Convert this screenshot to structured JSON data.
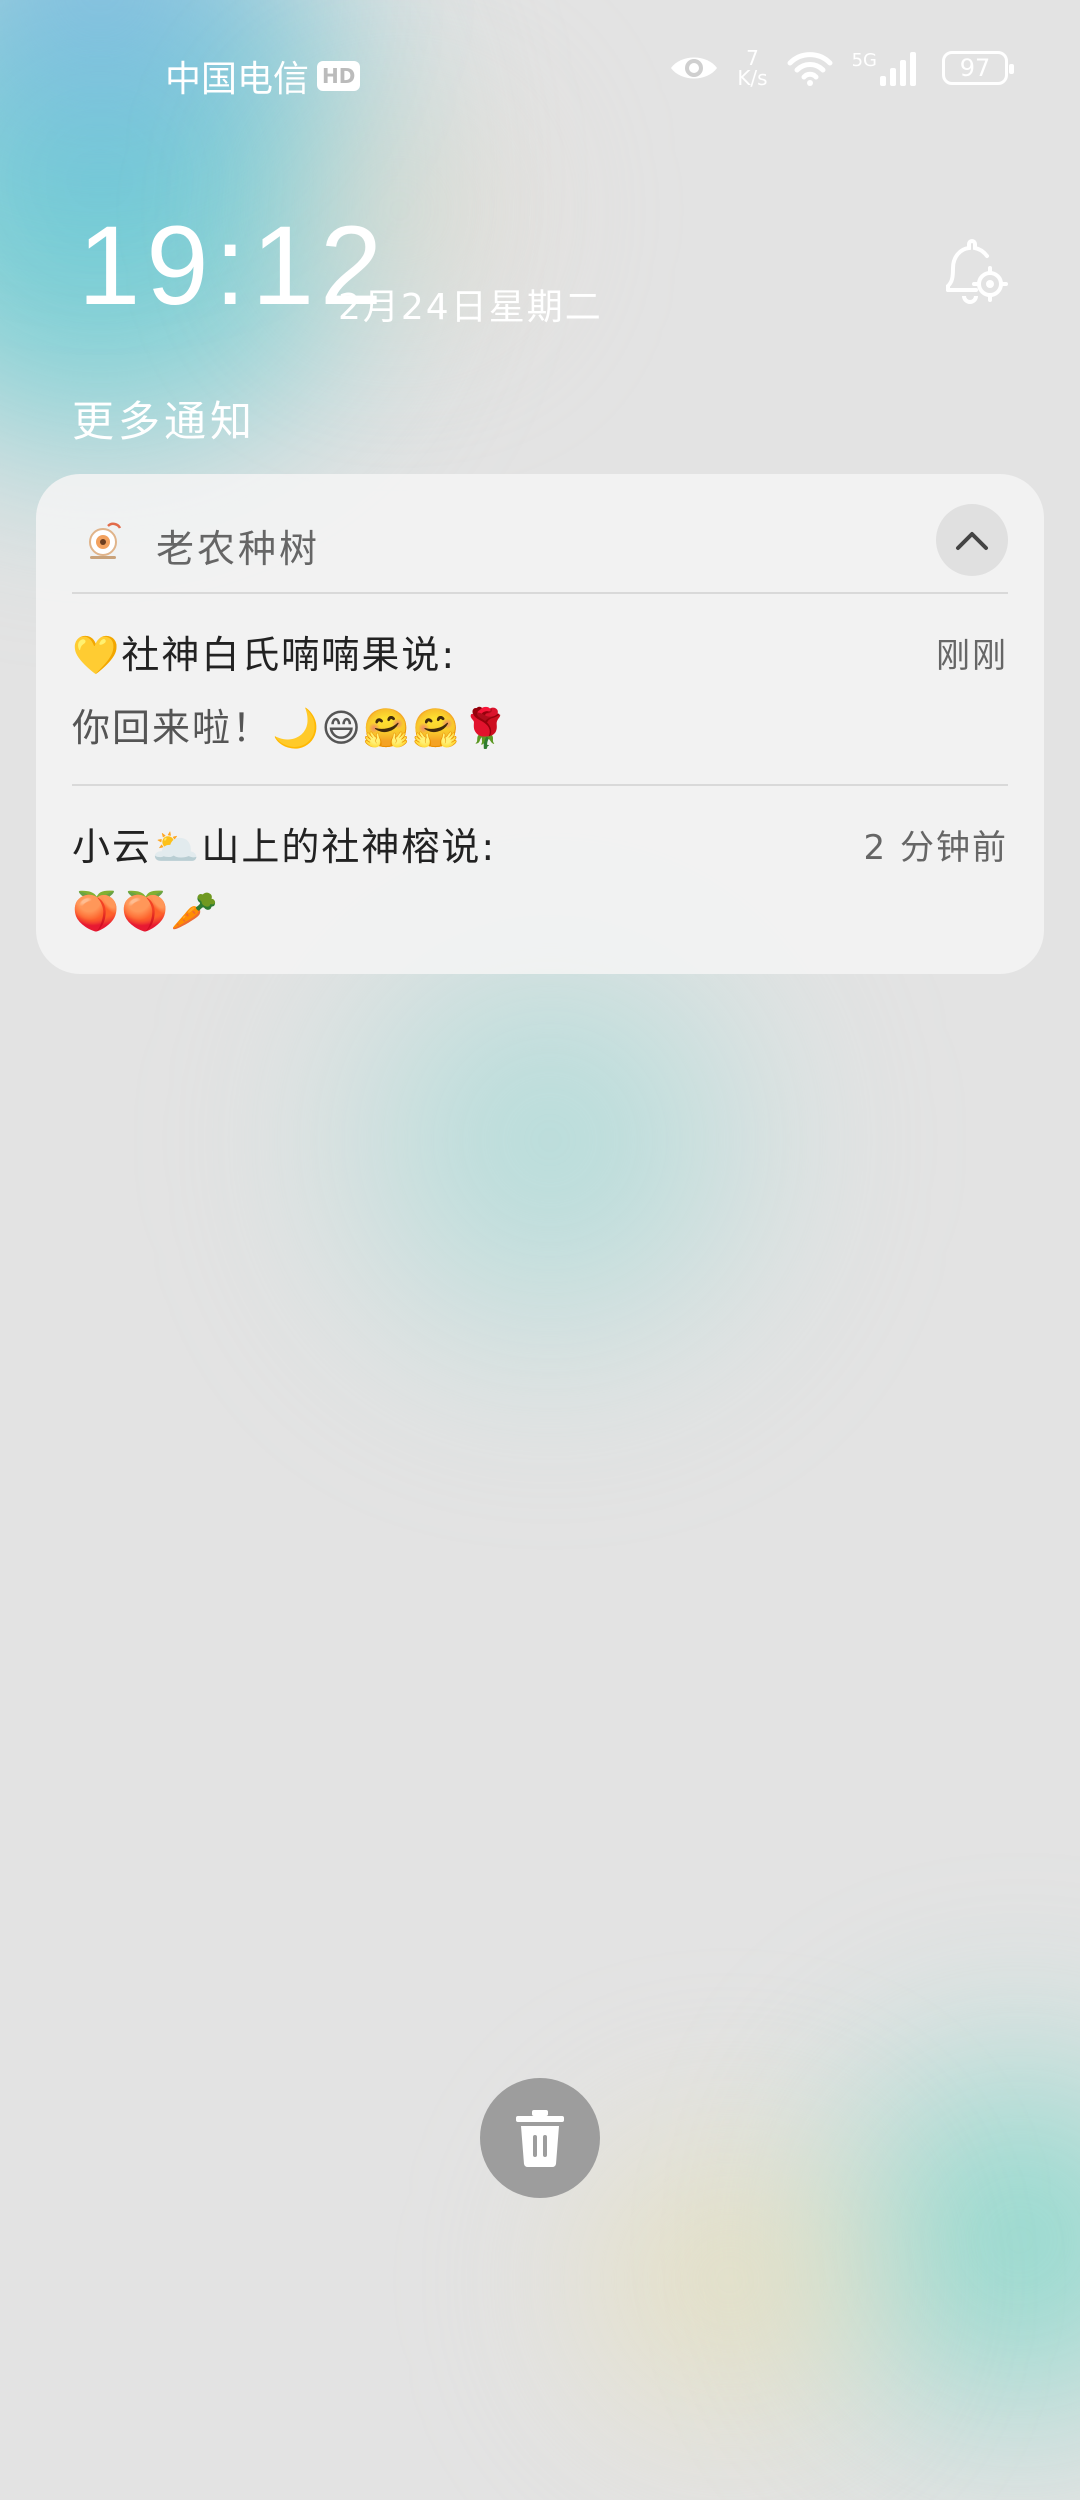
{
  "status_bar": {
    "carrier": "中国电信",
    "hd_badge": "HD",
    "speed_value": "7",
    "speed_unit": "K/s",
    "network": "5G",
    "battery": "97"
  },
  "lockscreen": {
    "time": "19:12",
    "date": "2月24日星期二"
  },
  "section_title": "更多通知",
  "notification": {
    "app_name": "老农种树",
    "messages": [
      {
        "sender": "💛社神白氏喃喃果说:",
        "time": "刚刚",
        "text": "你回来啦！🌙😄🤗🤗🌹"
      },
      {
        "sender": "小云🌥️山上的社神榕说:",
        "time": "2 分钟前",
        "text": "🍑🍑🥕"
      }
    ]
  },
  "icons": {
    "eye": "eye-icon",
    "wifi": "wifi-icon",
    "signal": "signal-icon",
    "bell_settings": "bell-settings-icon",
    "collapse": "chevron-up-icon",
    "delete": "trash-icon"
  }
}
